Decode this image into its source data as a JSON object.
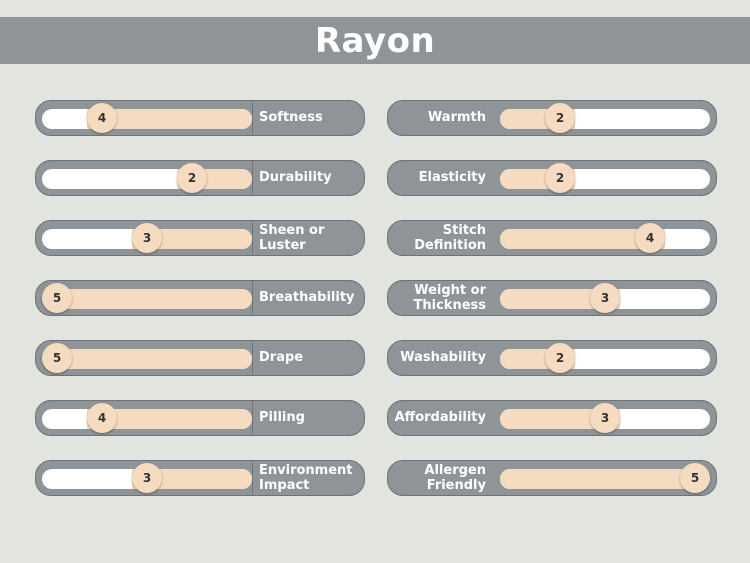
{
  "title": "Rayon",
  "colors": {
    "background": "#e2e4df",
    "bar": "#8f9499",
    "fill": "#f5dcc0",
    "track": "#ffffff"
  },
  "scale_max": 5,
  "left": [
    {
      "label": "Softness",
      "value": 4
    },
    {
      "label": "Durability",
      "value": 2
    },
    {
      "label": "Sheen or Luster",
      "value": 3
    },
    {
      "label": "Breathability",
      "value": 5
    },
    {
      "label": "Drape",
      "value": 5
    },
    {
      "label": "Pilling",
      "value": 4
    },
    {
      "label": "Environment Impact",
      "value": 3
    }
  ],
  "right": [
    {
      "label": "Warmth",
      "value": 2
    },
    {
      "label": "Elasticity",
      "value": 2
    },
    {
      "label": "Stitch Definition",
      "value": 4
    },
    {
      "label": "Weight or Thickness",
      "value": 3
    },
    {
      "label": "Washability",
      "value": 2
    },
    {
      "label": "Affordability",
      "value": 3
    },
    {
      "label": "Allergen Friendly",
      "value": 5
    }
  ]
}
